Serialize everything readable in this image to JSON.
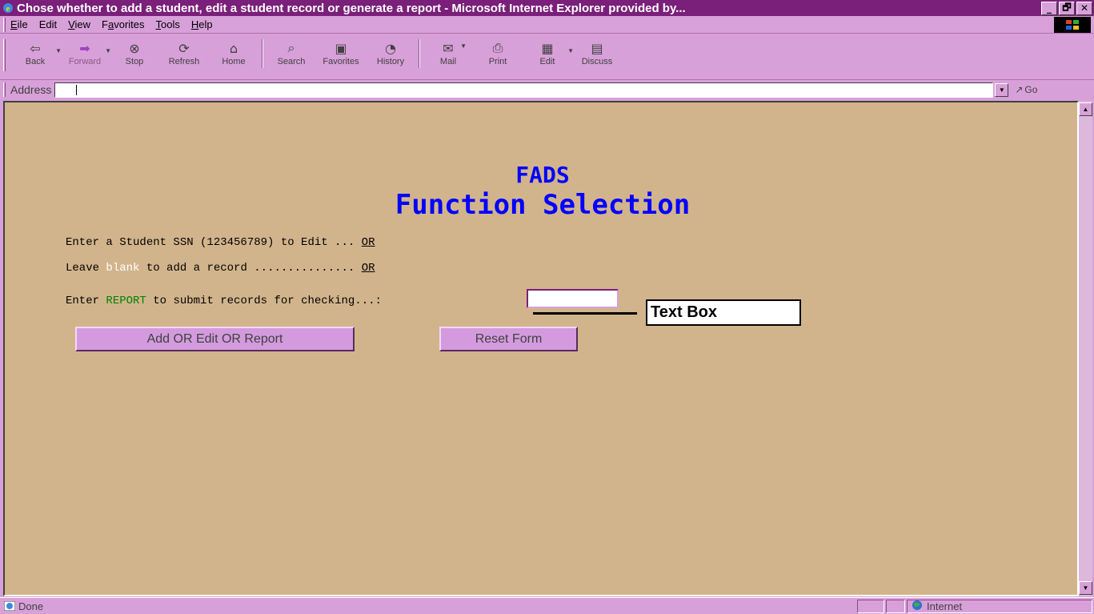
{
  "window": {
    "title": "Chose whether to add a student, edit a student record or generate a report - Microsoft Internet Explorer provided by...",
    "controls": {
      "minimize": "_",
      "maximize": "🗗",
      "close": "✕"
    }
  },
  "menu": {
    "items": [
      {
        "key": "E",
        "rest": "ile",
        "full": "File"
      },
      {
        "key": "",
        "rest": "Edit",
        "full": "Edit"
      },
      {
        "key": "V",
        "rest": "iew",
        "full": "View"
      },
      {
        "key": "a",
        "prefix": "F",
        "rest": "vorites",
        "full": "Favorites"
      },
      {
        "key": "T",
        "rest": "ools",
        "full": "Tools"
      },
      {
        "key": "H",
        "rest": "elp",
        "full": "Help"
      }
    ]
  },
  "toolbar": {
    "back": "Back",
    "forward": "Forward",
    "stop": "Stop",
    "refresh": "Refresh",
    "home": "Home",
    "search": "Search",
    "favorites": "Favorites",
    "history": "History",
    "mail": "Mail",
    "print": "Print",
    "edit": "Edit",
    "discuss": "Discuss"
  },
  "address": {
    "label": "Address",
    "value": "",
    "go_label": "Go"
  },
  "page": {
    "title_line1": "FADS",
    "title_line2": "Function Selection",
    "line1_text": "Enter a Student SSN (123456789) to Edit ... ",
    "line1_or": "OR",
    "line2_prefix": "Leave ",
    "line2_blank": "blank",
    "line2_suffix": " to add a record ............... ",
    "line2_or": "OR",
    "line3_prefix": "Enter ",
    "line3_report": "REPORT",
    "line3_suffix": " to submit records for checking...:",
    "report_input_value": "",
    "callout": "Text Box",
    "submit_button": "Add OR Edit OR Report",
    "reset_button": "Reset Form",
    "background_color": "#d2b48c",
    "title_color": "#0000ff"
  },
  "status": {
    "text": "Done",
    "zone": "Internet"
  }
}
